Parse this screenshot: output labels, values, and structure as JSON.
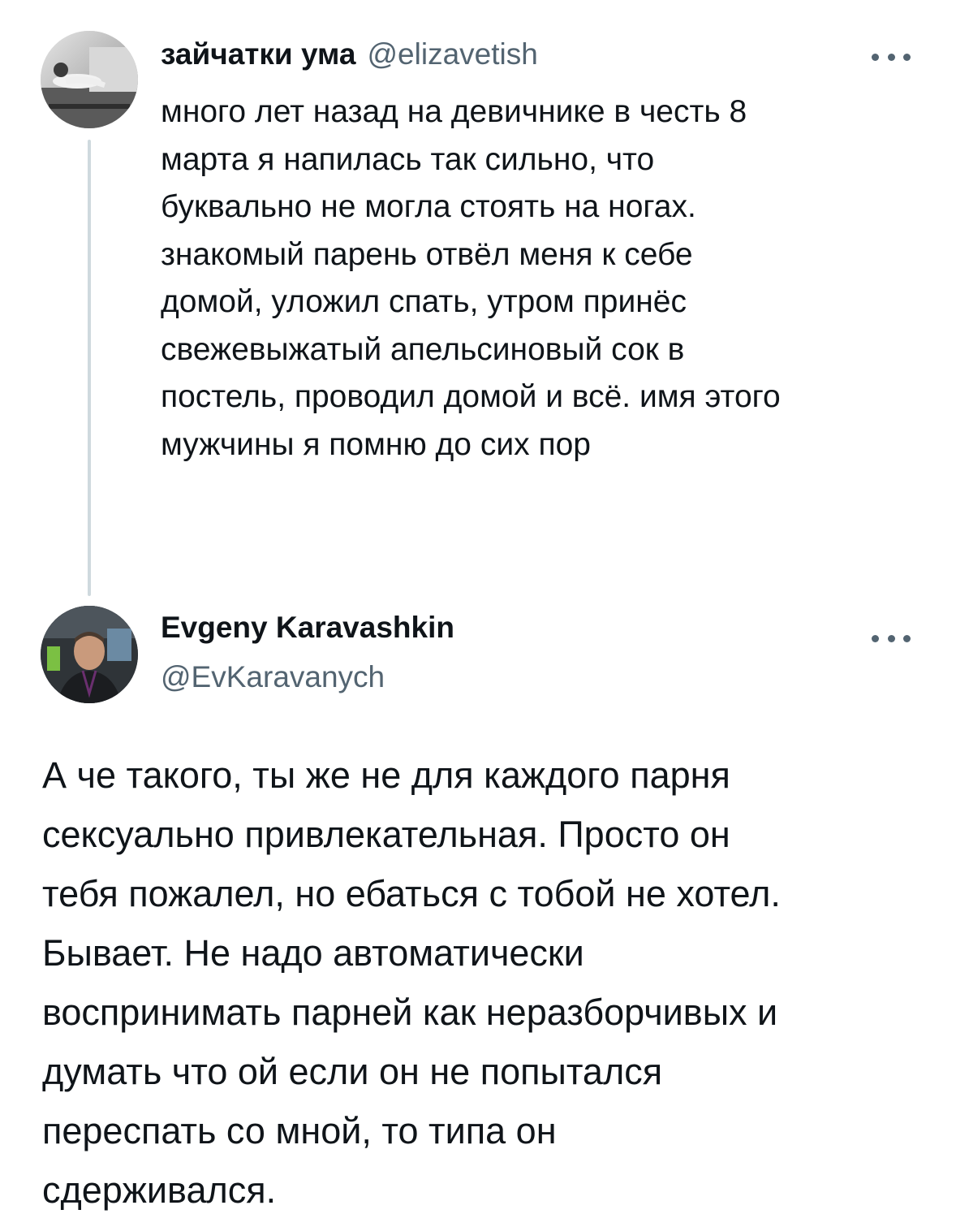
{
  "parent_tweet": {
    "display_name": "зайчатки ума",
    "handle": "@elizavetish",
    "more_icon": "more-horizontal-icon",
    "text": "много лет назад на девичнике в честь 8\nмарта я напилась так сильно, что\nбуквально не могла стоять на ногах.\nзнакомый парень отвёл меня к себе\nдомой, уложил спать, утром принёс\nсвежевыжатый апельсиновый сок в\nпостель, проводил домой и всё. имя этого\nмужчины я помню до сих пор"
  },
  "reply_tweet": {
    "display_name": "Evgeny Karavashkin",
    "handle": "@EvKaravanych",
    "more_icon": "more-horizontal-icon",
    "text": "А че такого, ты же не для каждого парня\nсексуально привлекательная. Просто он\nтебя пожалел, но ебаться с тобой не хотел.\nБывает. Не надо автоматически\nвоспринимать парней как неразборчивых и\nдумать что ой если он не попытался\nпереспать со мной, то типа он\nсдерживался."
  },
  "colors": {
    "background": "#ffffff",
    "primary_text": "#0f1419",
    "secondary_text": "#536471",
    "thread_line": "#cfd9de"
  }
}
